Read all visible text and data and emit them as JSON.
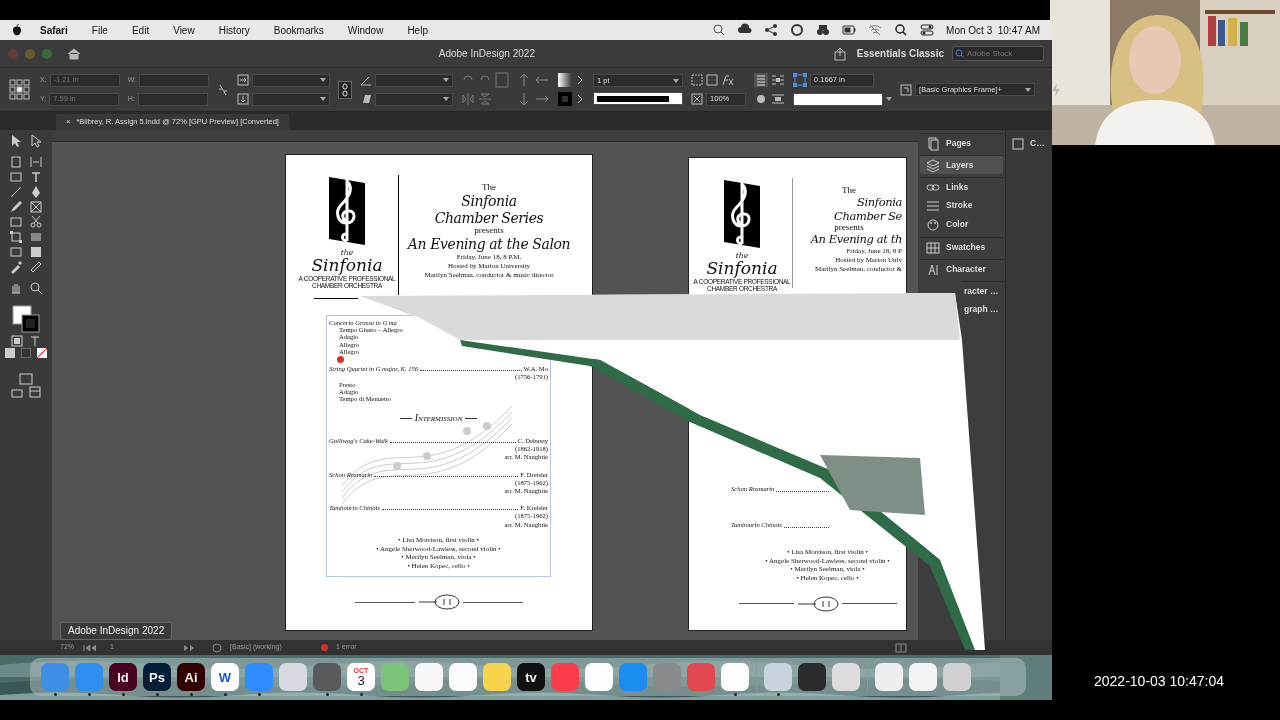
{
  "menu_bar": {
    "app": "Safari",
    "items": [
      "File",
      "Edit",
      "View",
      "History",
      "Bookmarks",
      "Window",
      "Help"
    ],
    "clock": "Mon Oct 3  10:47 AM"
  },
  "window": {
    "title": "Adobe InDesign 2022",
    "workspace": "Essentials Classic",
    "search": {
      "placeholder": "Adobe Stock"
    }
  },
  "control_panel": {
    "x_label": "X:",
    "x_value": "-1.21 in",
    "y_label": "Y:",
    "y_value": "7.59 in",
    "w_label": "W:",
    "h_label": "H:",
    "stroke_weight": "1 pt",
    "opacity": "100%",
    "corner_size": "0.1667 in",
    "object_style": "[Basic Graphics Frame]+"
  },
  "document_tab": {
    "close": "×",
    "label": "*Bilbrey, R. Assign 5.indd @ 72% [GPU Preview] [Converted]"
  },
  "left_page": {
    "logo": {
      "the": "the",
      "name": "Sinfonia",
      "tagline": [
        "A COOPERATIVE PROFESSIONAL",
        "CHAMBER ORCHESTRA"
      ]
    },
    "title_lines": [
      {
        "text": "The",
        "kind": "plain"
      },
      {
        "text": "Sinfonia",
        "kind": "script"
      },
      {
        "text": "Chamber Series",
        "kind": "script"
      },
      {
        "text": "presents",
        "kind": "plain"
      },
      {
        "text": "An Evening at the Salon",
        "kind": "script"
      },
      {
        "text": "Friday, June 18, 8 P.M.",
        "kind": "small"
      },
      {
        "text": "Hosted by Marion University",
        "kind": "small"
      },
      {
        "text": "Marilyn Seelman, conductor & music director",
        "kind": "small"
      }
    ],
    "program": [
      {
        "kind": "piece",
        "title": "Concerto Grosso in G ma",
        "movements": [
          "Tempo Giusto – Allegro",
          "Adagio",
          "Allegro",
          "Allegro"
        ]
      },
      {
        "kind": "piece",
        "error": true,
        "title": "String Quartet in G major, K. 156",
        "composer": "W.A. Mo",
        "details": [
          "(1756-1791)"
        ],
        "movements": [
          "Presto",
          "Adagio",
          "Tempo di Menuetto"
        ]
      },
      {
        "kind": "intermission",
        "title": "Intermission"
      },
      {
        "kind": "piece",
        "title": "Golliwog's Cake-Walk",
        "composer": "C. Debussy",
        "details": [
          "(1862-1918)",
          "arr. M. Naughtie"
        ]
      },
      {
        "kind": "piece",
        "title": "Schon Rosmarin",
        "composer": "F. Dreisler",
        "details": [
          "(1875-1962)",
          "arr. M. Naughtie"
        ]
      },
      {
        "kind": "piece",
        "title": "Tambourin Chinois",
        "composer": "F. Kreisler",
        "details": [
          "(1875-1962)",
          "arr. M. Naughtie"
        ]
      }
    ],
    "musicians": [
      "• Lisa Morrison, first violin •",
      "• Angele Sherwood-Lawless, second violin •",
      "• Merilyn Seelman, viola •",
      "• Helen Kopec, cello •"
    ]
  },
  "right_page": {
    "logo": {
      "the": "the",
      "name": "Sinfonia",
      "tagline": [
        "A COOPERATIVE PROFESSIONAL",
        "CHAMBER ORCHESTRA"
      ]
    },
    "title_lines": [
      {
        "text": "The",
        "kind": "plain",
        "cut": false
      },
      {
        "text": "Sinfonia",
        "kind": "script",
        "cut": true
      },
      {
        "text": "Chamber Se",
        "kind": "script",
        "cut": true
      },
      {
        "text": "presents",
        "kind": "plain",
        "cut": false
      },
      {
        "text": "An Evening at th",
        "kind": "script",
        "cut": true
      },
      {
        "text": "Friday, June 18, 8 P",
        "kind": "small",
        "cut": true
      },
      {
        "text": "Hosted by Marion Univ",
        "kind": "small",
        "cut": true
      },
      {
        "text": "Marilyn Seelman, conductor &",
        "kind": "small",
        "cut": true
      }
    ],
    "program": [
      {
        "title": "Schon Rosmarin"
      },
      {
        "title": "Tambourin Chinois"
      }
    ],
    "musicians": [
      "• Lisa Morrison, first violin •",
      "• Angele Sherwood-Lawless, second violin •",
      "• Merilyn Seelman, viola •",
      "• Helen Kopec, cello •"
    ]
  },
  "panels": [
    {
      "label": "Pages",
      "kind": "full",
      "selected": false,
      "group_start": true
    },
    {
      "label": "Layers",
      "kind": "full",
      "selected": true,
      "group_start": true
    },
    {
      "label": "Links",
      "kind": "full",
      "selected": false,
      "group_start": true
    },
    {
      "label": "Stroke",
      "kind": "full",
      "selected": false,
      "group_start": false
    },
    {
      "label": "Color",
      "kind": "full",
      "selected": false,
      "group_start": false
    },
    {
      "label": "Swatches",
      "kind": "full",
      "selected": false,
      "group_start": true
    },
    {
      "label": "Character",
      "kind": "full",
      "selected": false,
      "group_start": true
    },
    {
      "label": "racter …",
      "kind": "partial",
      "selected": false,
      "group_start": true
    },
    {
      "label": "graph …",
      "kind": "partial",
      "selected": false,
      "group_start": false
    }
  ],
  "side_panel": {
    "label": "C…"
  },
  "status_bar": {
    "zoom": "72%",
    "page": "1",
    "preflight_profile": "[Basic] (working)",
    "errors": "1 error"
  },
  "tooltip": "Adobe InDesign 2022",
  "dock": [
    {
      "kind": "app",
      "color": "#3d8fe8",
      "running": true
    },
    {
      "kind": "app",
      "color": "#2f8ff0",
      "running": true
    },
    {
      "kind": "app",
      "color": "#49021f",
      "label": "Id",
      "running": true
    },
    {
      "kind": "app",
      "color": "#001e36",
      "label": "Ps",
      "running": true
    },
    {
      "kind": "app",
      "color": "#330000",
      "label": "Ai",
      "running": true
    },
    {
      "kind": "app",
      "color": "#ffffff",
      "label": "W",
      "running": true
    },
    {
      "kind": "app",
      "color": "#2d8cff",
      "running": true
    },
    {
      "kind": "app",
      "color": "#d8d8e0",
      "running": false
    },
    {
      "kind": "app",
      "color": "#5a5a5a",
      "running": true
    },
    {
      "kind": "calendar",
      "color": "#ffffff",
      "month": "OCT",
      "label": "3",
      "running": true
    },
    {
      "kind": "app",
      "color": "#7cc47c",
      "running": false
    },
    {
      "kind": "app",
      "color": "#f7f7f7",
      "running": false
    },
    {
      "kind": "app",
      "color": "#fbfbfb",
      "running": false
    },
    {
      "kind": "app",
      "color": "#f6d44c",
      "running": false
    },
    {
      "kind": "app",
      "color": "#111111",
      "label": "tv",
      "running": false
    },
    {
      "kind": "app",
      "color": "#fa3c4c",
      "running": false
    },
    {
      "kind": "app",
      "color": "#fefefe",
      "running": false
    },
    {
      "kind": "app",
      "color": "#1c8cf0",
      "running": false
    },
    {
      "kind": "app",
      "color": "#8a8a8a",
      "running": false
    },
    {
      "kind": "app",
      "color": "#e34850",
      "running": false
    },
    {
      "kind": "app",
      "color": "#fdfdfd",
      "running": true
    },
    {
      "kind": "separator"
    },
    {
      "kind": "app",
      "color": "#c9d3de",
      "running": true
    },
    {
      "kind": "app",
      "color": "#2b2b2b",
      "running": false
    },
    {
      "kind": "app",
      "color": "#dcdcdc",
      "running": false
    },
    {
      "kind": "separator"
    },
    {
      "kind": "app",
      "color": "#eeeeee",
      "running": false
    },
    {
      "kind": "app",
      "color": "#f4f4f4",
      "running": false
    },
    {
      "kind": "app",
      "color": "#d0d0d0",
      "running": false
    }
  ],
  "recording_timestamp": "2022-10-03 10:47:04"
}
